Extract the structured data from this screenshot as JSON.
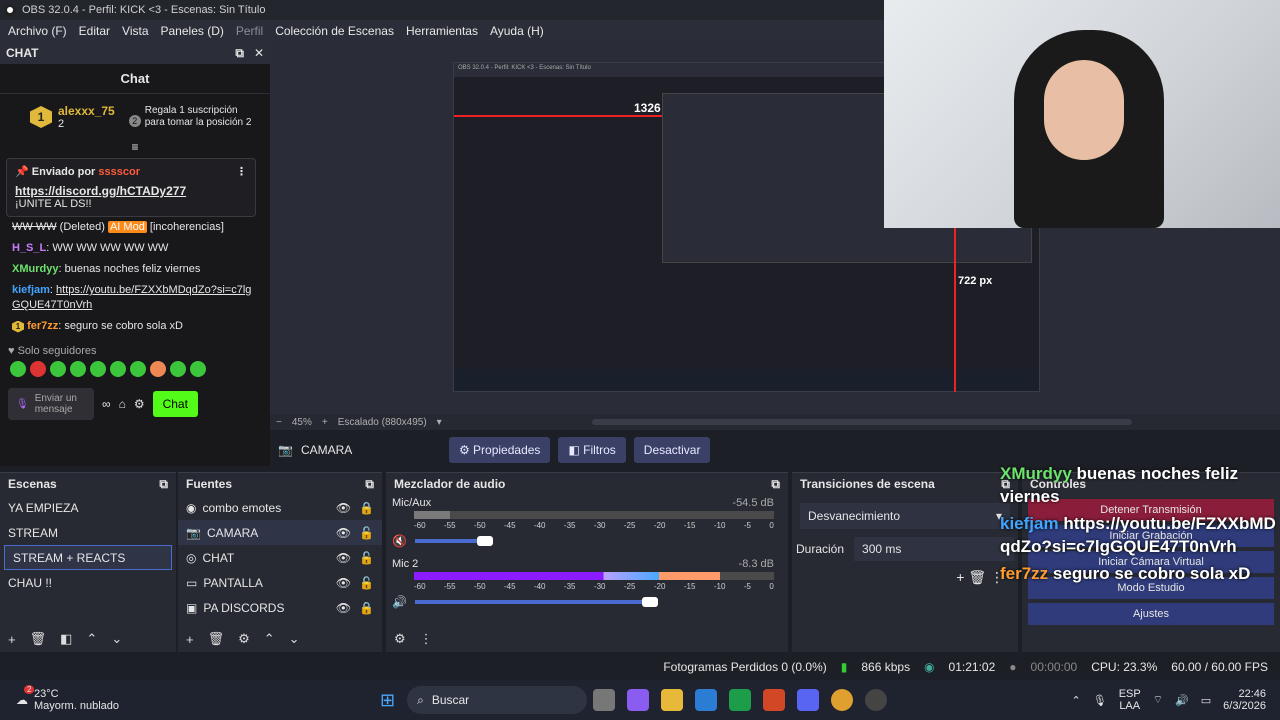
{
  "window": {
    "title": "OBS 32.0.4 - Perfil: KICK <3 - Escenas: Sin Título"
  },
  "menu": [
    "Archivo (F)",
    "Editar",
    "Vista",
    "Paneles (D)",
    "Perfil",
    "Colección de Escenas",
    "Herramientas",
    "Ayuda (H)"
  ],
  "chat": {
    "dock_title": "CHAT",
    "title": "Chat",
    "leader": {
      "rank": "1",
      "name": "alexxx_75",
      "count": "2",
      "rank2": "2",
      "promo": "Regala 1 suscripción para tomar la posición 2"
    },
    "pinned": {
      "header": "Enviado por",
      "user": "sssscor",
      "link": "https://discord.gg/hCTADy277",
      "text": "¡UNITE AL DS!!"
    },
    "messages": [
      {
        "user": "WW WW",
        "suffix": "(Deleted)",
        "badge": "AI Mod",
        "text": "[incoherencias]"
      },
      {
        "user": "H_S_L",
        "text": "WW WW WW WW WW"
      },
      {
        "user": "XMurdyy",
        "text": "buenas noches feliz viernes"
      },
      {
        "user": "kiefjam",
        "text": "https://youtu.be/FZXXbMDqdZo?si=c7lgGQUE47T0nVrh"
      },
      {
        "user": "fer7zz",
        "rank": "1",
        "text": "seguro se cobro sola xD"
      }
    ],
    "followers_only": "Solo seguidores",
    "input_placeholder": "Enviar un mensaje",
    "send_label": "Chat"
  },
  "preview": {
    "zoom": "45%",
    "scaling": "Escalado (880x495)",
    "measure_h": "1326 px",
    "measure_v": "722 px"
  },
  "source_bar": {
    "source": "CAMARA",
    "properties": "Propiedades",
    "filters": "Filtros",
    "deactivate": "Desactivar"
  },
  "scenes": {
    "title": "Escenas",
    "items": [
      "YA EMPIEZA",
      "STREAM",
      "STREAM + REACTS",
      "CHAU !!"
    ],
    "selected": 2
  },
  "sources": {
    "title": "Fuentes",
    "items": [
      "combo emotes",
      "CAMARA",
      "CHAT",
      "PANTALLA",
      "PA DISCORDS"
    ]
  },
  "mixer": {
    "title": "Mezclador de audio",
    "channels": [
      {
        "name": "Mic/Aux",
        "db": "-54.5 dB",
        "level": 0.1
      },
      {
        "name": "Mic 2",
        "db": "-8.3 dB",
        "level": 0.85
      }
    ],
    "ticks": [
      "-60",
      "-55",
      "-50",
      "-45",
      "-40",
      "-35",
      "-30",
      "-25",
      "-20",
      "-15",
      "-10",
      "-5",
      "0"
    ]
  },
  "transitions": {
    "title": "Transiciones de escena",
    "type": "Desvanecimiento",
    "duration_label": "Duración",
    "duration": "300 ms"
  },
  "controls": {
    "title": "Controles",
    "buttons": [
      "Detener Transmisión",
      "Iniciar Grabación",
      "Iniciar Cámara Virtual",
      "Modo Estudio",
      "Ajustes"
    ]
  },
  "overlay_chat": [
    {
      "user": "XMurdyy",
      "text": "buenas noches feliz viernes"
    },
    {
      "user": "kiefjam",
      "text": "https://youtu.be/FZXXbMDqdZo?si=c7lgGQUE47T0nVrh"
    },
    {
      "user": "fer7zz",
      "text": "seguro se cobro sola xD"
    }
  ],
  "status": {
    "dropped": "Fotogramas Perdidos 0 (0.0%)",
    "kbps": "866 kbps",
    "stream_time": "01:21:02",
    "rec_time": "00:00:00",
    "cpu": "CPU: 23.3%",
    "fps": "60.00 / 60.00 FPS"
  },
  "taskbar": {
    "temp": "23°C",
    "weather": "Mayorm. nublado",
    "badge": "2",
    "search": "Buscar",
    "lang": "ESP",
    "lang2": "LAA",
    "time": "22:46",
    "date": "6/3/2026"
  }
}
